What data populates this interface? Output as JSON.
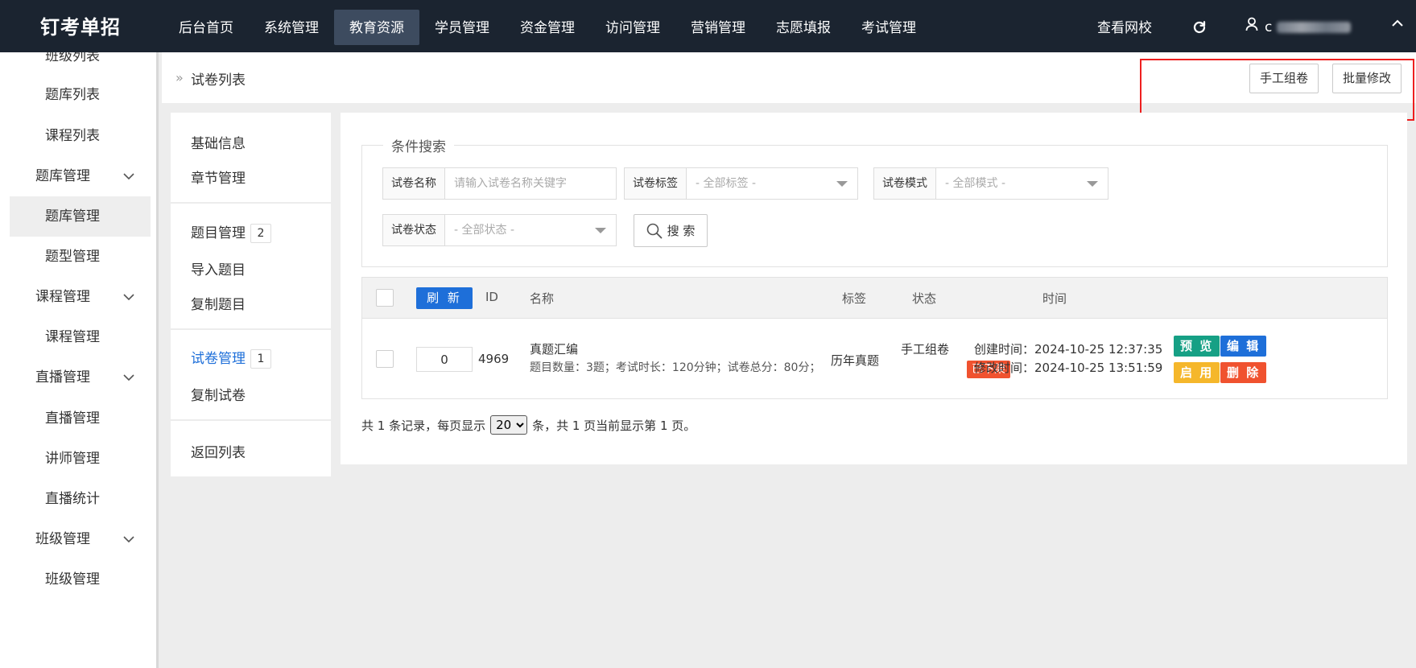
{
  "app": {
    "title": "钉考单招"
  },
  "topnav": {
    "items": [
      "后台首页",
      "系统管理",
      "教育资源",
      "学员管理",
      "资金管理",
      "访问管理",
      "营销管理",
      "志愿填报",
      "考试管理"
    ],
    "active": "教育资源",
    "view_school": "查看网校",
    "user_prefix": "c"
  },
  "sidebar": {
    "items": [
      {
        "label": "班级列表",
        "type": "sub"
      },
      {
        "label": "题库列表",
        "type": "sub"
      },
      {
        "label": "课程列表",
        "type": "sub"
      },
      {
        "label": "题库管理",
        "type": "group"
      },
      {
        "label": "题库管理",
        "type": "sub",
        "selected": true
      },
      {
        "label": "题型管理",
        "type": "sub"
      },
      {
        "label": "课程管理",
        "type": "group"
      },
      {
        "label": "课程管理",
        "type": "sub"
      },
      {
        "label": "直播管理",
        "type": "group"
      },
      {
        "label": "直播管理",
        "type": "sub"
      },
      {
        "label": "讲师管理",
        "type": "sub"
      },
      {
        "label": "直播统计",
        "type": "sub"
      },
      {
        "label": "班级管理",
        "type": "group"
      },
      {
        "label": "班级管理",
        "type": "sub"
      }
    ]
  },
  "header": {
    "breadcrumb": "试卷列表",
    "manual_button": "手工组卷",
    "batch_button": "批量修改"
  },
  "subnav": {
    "basic_info": "基础信息",
    "chapter_mgmt": "章节管理",
    "question_mgmt": "题目管理",
    "question_count": "2",
    "import_questions": "导入题目",
    "copy_questions": "复制题目",
    "paper_mgmt": "试卷管理",
    "paper_count": "1",
    "copy_paper": "复制试卷",
    "back_to_list": "返回列表"
  },
  "search": {
    "legend": "条件搜索",
    "name_label": "试卷名称",
    "name_placeholder": "请输入试卷名称关键字",
    "tag_label": "试卷标签",
    "tag_value": "- 全部标签 -",
    "mode_label": "试卷模式",
    "mode_value": "- 全部模式 -",
    "status_label": "试卷状态",
    "status_value": "- 全部状态 -",
    "search_button": "搜 索"
  },
  "table": {
    "refresh_button": "刷 新",
    "headers": {
      "id": "ID",
      "name": "名称",
      "tag": "标签",
      "status": "状态",
      "time": "时间"
    },
    "rows": [
      {
        "sort": "0",
        "id": "4969",
        "name": "真题汇编",
        "details": "题目数量：3题；考试时长：120分钟；试卷总分：80分；",
        "tag": "历年真题",
        "mode": "手工组卷",
        "status_badge": "已下架",
        "created": "创建时间：2024-10-25 12:37:35",
        "modified": "修改时间：2024-10-25 13:51:59",
        "actions": {
          "preview": "预 览",
          "edit": "编 辑",
          "enable": "启 用",
          "delete": "删 除"
        }
      }
    ]
  },
  "pager": {
    "prefix": "共 1 条记录，每页显示",
    "page_size": "20",
    "suffix": "条，共 1 页当前显示第 1 页。"
  },
  "colors": {
    "topbar": "#1b2430",
    "primary": "#1e6fd9",
    "preview": "#16a085",
    "enable": "#f5b72b",
    "danger": "#f0522f",
    "highlight_box": "#ee1f1f"
  }
}
